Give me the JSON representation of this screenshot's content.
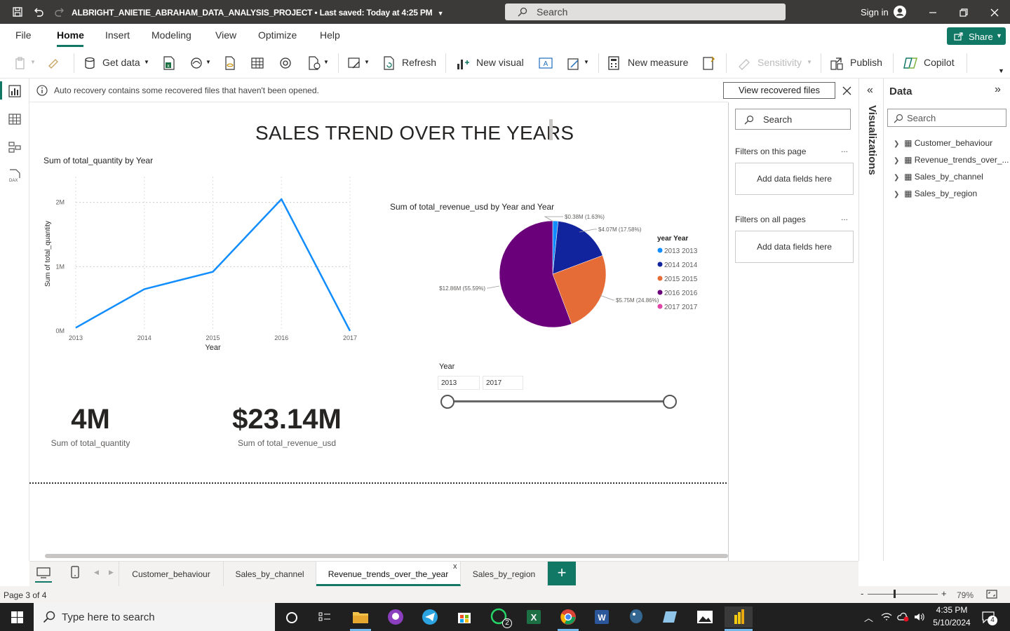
{
  "titlebar": {
    "title": "ALBRIGHT_ANIETIE_ABRAHAM_DATA_ANALYSIS_PROJECT",
    "saved": " • Last saved: Today at 4:25 PM",
    "search_placeholder": "Search",
    "signin": "Sign in"
  },
  "menu": {
    "items": [
      "File",
      "Home",
      "Insert",
      "Modeling",
      "View",
      "Optimize",
      "Help"
    ],
    "active": "Home",
    "share": "Share"
  },
  "ribbon": {
    "get_data": "Get data",
    "refresh": "Refresh",
    "new_visual": "New visual",
    "new_measure": "New measure",
    "sensitivity": "Sensitivity",
    "publish": "Publish",
    "copilot": "Copilot"
  },
  "infobar": {
    "message": "Auto recovery contains some recovered files that haven't been opened.",
    "button": "View recovered files"
  },
  "report": {
    "title": "SALES TREND OVER THE YEARS",
    "line_title": "Sum of total_quantity by Year",
    "pie_title": "Sum of total_revenue_usd by Year and Year",
    "slicer_label": "Year",
    "slicer_from": "2013",
    "slicer_to": "2017",
    "card1_value": "4M",
    "card1_label": "Sum of total_quantity",
    "card2_value": "$23.14M",
    "card2_label": "Sum of total_revenue_usd"
  },
  "chart_data": [
    {
      "type": "line",
      "title": "Sum of total_quantity by Year",
      "xlabel": "Year",
      "ylabel": "Sum of total_quantity",
      "x": [
        "2013",
        "2014",
        "2015",
        "2016",
        "2017"
      ],
      "y_ticks": [
        "0M",
        "1M",
        "2M"
      ],
      "ylim": [
        0,
        2400000
      ],
      "series": [
        {
          "values": [
            50000,
            650000,
            920000,
            2050000,
            0
          ]
        }
      ],
      "color": "#118DFF",
      "grid": true
    },
    {
      "type": "pie",
      "title": "Sum of total_revenue_usd by Year and Year",
      "legend_title": "year Year",
      "legend_position": "right",
      "slices": [
        {
          "label": "2013 2013",
          "value": 0.38,
          "data_label": "$0.38M (1.63%)",
          "color": "#118DFF"
        },
        {
          "label": "2014 2014",
          "value": 4.07,
          "data_label": "$4.07M (17.58%)",
          "color": "#12239E"
        },
        {
          "label": "2015 2015",
          "value": 5.75,
          "data_label": "$5.75M (24.86%)",
          "color": "#E66C37"
        },
        {
          "label": "2016 2016",
          "value": 12.86,
          "data_label": "$12.86M (55.59%)",
          "color": "#6B007B"
        },
        {
          "label": "2017 2017",
          "value": 0,
          "data_label": "",
          "color": "#E044A7"
        }
      ]
    }
  ],
  "filters": {
    "search_placeholder": "Search",
    "on_page": "Filters on this page",
    "on_all": "Filters on all pages",
    "add_fields": "Add data fields here",
    "more": "..."
  },
  "visualizations": {
    "label": "Visualizations"
  },
  "data_pane": {
    "title": "Data",
    "search_placeholder": "Search",
    "tables": [
      "Customer_behaviour",
      "Revenue_trends_over_...",
      "Sales_by_channel",
      "Sales_by_region"
    ]
  },
  "tabs": {
    "items": [
      "Customer_behaviour",
      "Sales_by_channel",
      "Revenue_trends_over_the_year",
      "Sales_by_region"
    ],
    "active_index": 2,
    "close": "x",
    "add": "+"
  },
  "status": {
    "page": "Page 3 of 4",
    "zoom": "79%"
  },
  "taskbar": {
    "search_placeholder": "Type here to search",
    "time": "4:35 PM",
    "date": "5/10/2024",
    "whatsapp_badge": "2",
    "notif_count": "4"
  }
}
